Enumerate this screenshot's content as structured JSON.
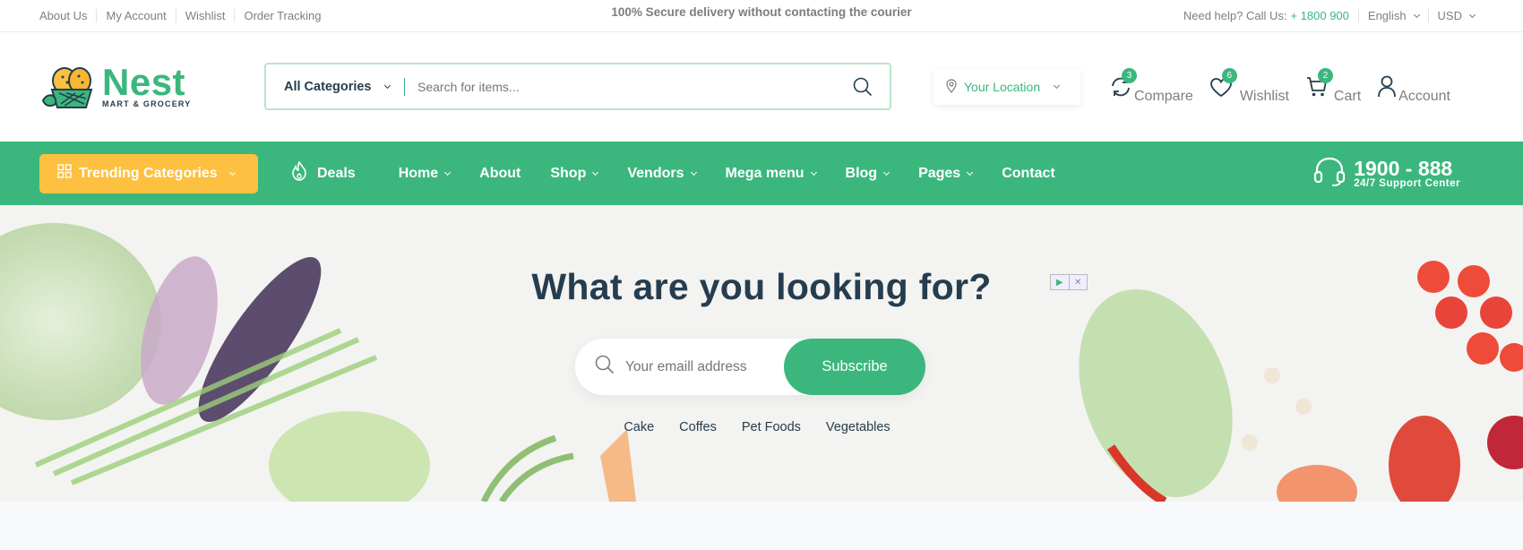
{
  "topbar": {
    "links": [
      "About Us",
      "My Account",
      "Wishlist",
      "Order Tracking"
    ],
    "announcement": "100% Secure delivery without contacting the courier",
    "help_label": "Need help? Call Us:",
    "help_phone": "+ 1800 900",
    "language": "English",
    "currency": "USD"
  },
  "logo": {
    "name": "Nest",
    "tagline": "MART & GROCERY"
  },
  "search": {
    "category": "All Categories",
    "placeholder": "Search for items..."
  },
  "location": {
    "label": "Your Location"
  },
  "header_icons": [
    {
      "label": "Compare",
      "count": "3",
      "icon": "compare-icon"
    },
    {
      "label": "Wishlist",
      "count": "6",
      "icon": "heart-icon"
    },
    {
      "label": "Cart",
      "count": "2",
      "icon": "cart-icon"
    },
    {
      "label": "Account",
      "count": "",
      "icon": "user-icon"
    }
  ],
  "nav": {
    "trending": "Trending Categories",
    "deals": "Deals",
    "menu": [
      "Home",
      "About",
      "Shop",
      "Vendors",
      "Mega menu",
      "Blog",
      "Pages",
      "Contact"
    ],
    "support_phone": "1900 - 888",
    "support_label": "24/7 Support Center"
  },
  "hero": {
    "title": "What are you looking for?",
    "email_placeholder": "Your emaill address",
    "subscribe_label": "Subscribe",
    "tags": [
      "Cake",
      "Coffes",
      "Pet Foods",
      "Vegetables"
    ]
  },
  "colors": {
    "brand": "#3bb77e",
    "accent": "#fdc040",
    "text": "#253d4e"
  }
}
